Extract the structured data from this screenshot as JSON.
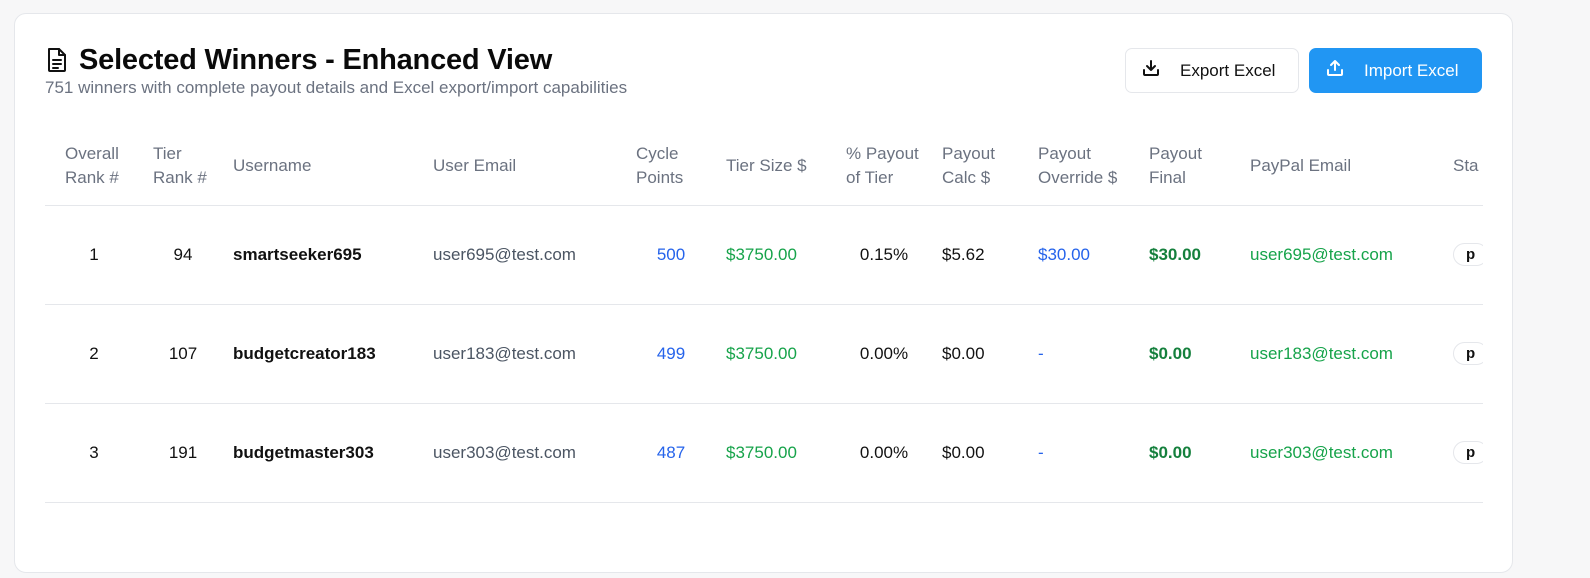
{
  "header": {
    "title": "Selected Winners - Enhanced View",
    "subtitle": "751 winners with complete payout details and Excel export/import capabilities",
    "icon": "document-icon"
  },
  "actions": {
    "export_label": "Export Excel",
    "import_label": "Import Excel",
    "export_icon": "download-icon",
    "import_icon": "upload-icon",
    "primary_color": "#2196f3"
  },
  "table": {
    "columns": {
      "overall_rank": "Overall Rank #",
      "tier_rank": "Tier Rank #",
      "username": "Username",
      "user_email": "User Email",
      "cycle_points": "Cycle Points",
      "tier_size": "Tier Size $",
      "payout_pct": "% Payout of Tier",
      "payout_calc": "Payout Calc $",
      "payout_override": "Payout Override $",
      "payout_final": "Payout Final",
      "paypal_email": "PayPal Email",
      "status": "Sta"
    },
    "rows": [
      {
        "overall_rank": "1",
        "tier_rank": "94",
        "username": "smartseeker695",
        "user_email": "user695@test.com",
        "cycle_points": "500",
        "tier_size": "$3750.00",
        "payout_pct": "0.15%",
        "payout_calc": "$5.62",
        "payout_override": "$30.00",
        "payout_final": "$30.00",
        "paypal_email": "user695@test.com",
        "status": "p"
      },
      {
        "overall_rank": "2",
        "tier_rank": "107",
        "username": "budgetcreator183",
        "user_email": "user183@test.com",
        "cycle_points": "499",
        "tier_size": "$3750.00",
        "payout_pct": "0.00%",
        "payout_calc": "$0.00",
        "payout_override": "-",
        "payout_final": "$0.00",
        "paypal_email": "user183@test.com",
        "status": "p"
      },
      {
        "overall_rank": "3",
        "tier_rank": "191",
        "username": "budgetmaster303",
        "user_email": "user303@test.com",
        "cycle_points": "487",
        "tier_size": "$3750.00",
        "payout_pct": "0.00%",
        "payout_calc": "$0.00",
        "payout_override": "-",
        "payout_final": "$0.00",
        "paypal_email": "user303@test.com",
        "status": "p"
      }
    ]
  }
}
